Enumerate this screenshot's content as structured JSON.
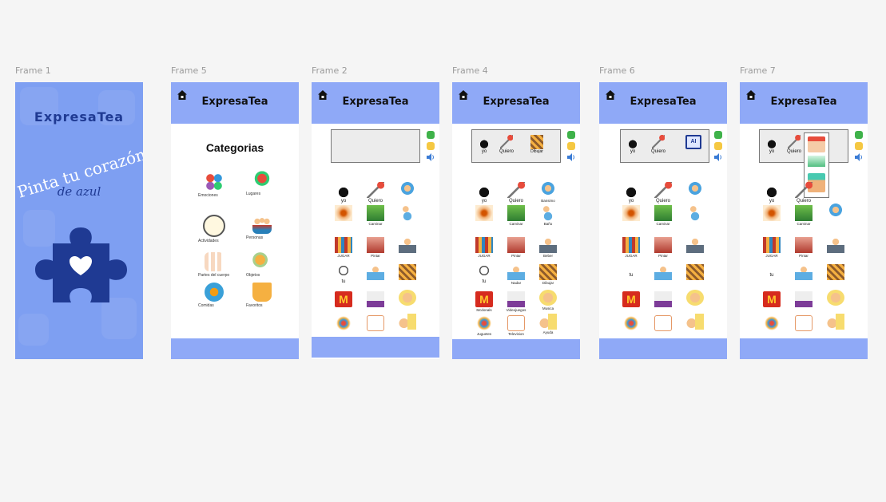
{
  "canvas": {
    "background": "#f5f5f5",
    "label_color": "#9b9b9b"
  },
  "app": {
    "name": "ExpresaTea",
    "header_color": "#8fa9f7",
    "accent": "#1f3a93"
  },
  "frames": [
    {
      "label": "Frame 1"
    },
    {
      "label": "Frame 5"
    },
    {
      "label": "Frame 2"
    },
    {
      "label": "Frame 4"
    },
    {
      "label": "Frame 6"
    },
    {
      "label": "Frame 7"
    }
  ],
  "splash": {
    "title": "ExpresaTea",
    "tagline_1": "Pinta tu corazón",
    "tagline_2": "de azul",
    "logo_icon": "puzzle-heart-icon"
  },
  "categories": {
    "title": "Categorias",
    "items": [
      {
        "label": "Emociones",
        "icon": "emotions-icon"
      },
      {
        "label": "Lugares",
        "icon": "places-icon"
      },
      {
        "label": "Actividades",
        "icon": "activities-icon"
      },
      {
        "label": "Personas",
        "icon": "people-icon"
      },
      {
        "label": "Partes del cuerpo",
        "icon": "body-parts-icon"
      },
      {
        "label": "Objetos",
        "icon": "objects-icon"
      },
      {
        "label": "Comidas",
        "icon": "food-icon"
      },
      {
        "label": "Favoritos",
        "icon": "favorites-icon"
      }
    ]
  },
  "phrase_tokens": {
    "yo": "yo",
    "quiero": "Quiero",
    "dibujar": "Dibujar"
  },
  "grid_labels": {
    "yo": "yo",
    "quiero": "Quiero",
    "bansimo": "Bansimo",
    "caminar": "Caminar",
    "bano": "Baño",
    "jugar": "JUGAR",
    "pintar": "Pintar",
    "beber": "Beber",
    "tu": "tu",
    "nadar": "Nadar",
    "dibujar": "Dibujar",
    "mcdonals": "Mcdonals",
    "videojuegos": "Videojuegos",
    "musica": "Musica",
    "juguetes": "Juguetes",
    "television": "Television",
    "ayuda": "Ayuda"
  },
  "controls": {
    "confirm_color": "#3fb24a",
    "clear_color": "#f5c842",
    "speaker_icon": "speaker-icon"
  }
}
